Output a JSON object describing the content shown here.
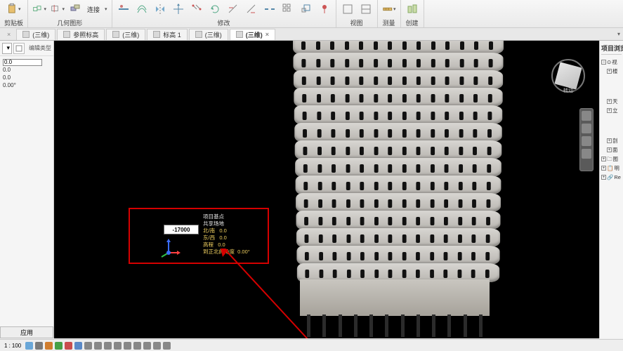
{
  "ribbon": {
    "groups": [
      {
        "label": "剪贴板"
      },
      {
        "label": "几何图形",
        "connect_label": "连接"
      },
      {
        "label": "修改"
      },
      {
        "label": "视图"
      },
      {
        "label": "测量"
      },
      {
        "label": "创建"
      }
    ]
  },
  "tabs": [
    {
      "label": "(三维)",
      "active": false,
      "closable": true
    },
    {
      "label": "参照标高",
      "active": false,
      "closable": false
    },
    {
      "label": "(三维)",
      "active": false,
      "closable": false
    },
    {
      "label": "标高 1",
      "active": false,
      "closable": false
    },
    {
      "label": "(三维)",
      "active": false,
      "closable": false
    },
    {
      "label": "(三维)",
      "active": true,
      "closable": true
    }
  ],
  "properties": {
    "edit_type_label": "编辑类型",
    "rows": [
      {
        "value": "0.0",
        "editable": true
      },
      {
        "value": "0.0",
        "editable": false
      },
      {
        "value": "0.0",
        "editable": false
      },
      {
        "value": "0.00°",
        "editable": false
      }
    ],
    "apply_label": "应用"
  },
  "viewport": {
    "viewcube_label": "转动",
    "input_value": "-17000",
    "coord": {
      "title": "项目基点",
      "shared": "共享场地",
      "rows": [
        {
          "label": "北/南",
          "value": "0.0"
        },
        {
          "label": "东/西",
          "value": "0.0"
        },
        {
          "label": "高程",
          "value": "0.0"
        },
        {
          "label": "到正北的角度",
          "value": "0.00°"
        }
      ]
    }
  },
  "browser": {
    "title": "项目浏览器",
    "roots": [
      "视",
      "楼"
    ],
    "items": [
      "天",
      "立",
      "剖",
      "面",
      "图",
      "明",
      "Re"
    ]
  },
  "status": {
    "scale_prefix": "1 :",
    "scale_value": "100",
    "icon_colors": [
      "#6aa7d8",
      "#7a7a7a",
      "#d07d2e",
      "#46a046",
      "#c94d4d",
      "#5a89c7",
      "#888",
      "#888",
      "#888",
      "#888",
      "#888",
      "#888",
      "#888",
      "#888",
      "#888"
    ]
  }
}
